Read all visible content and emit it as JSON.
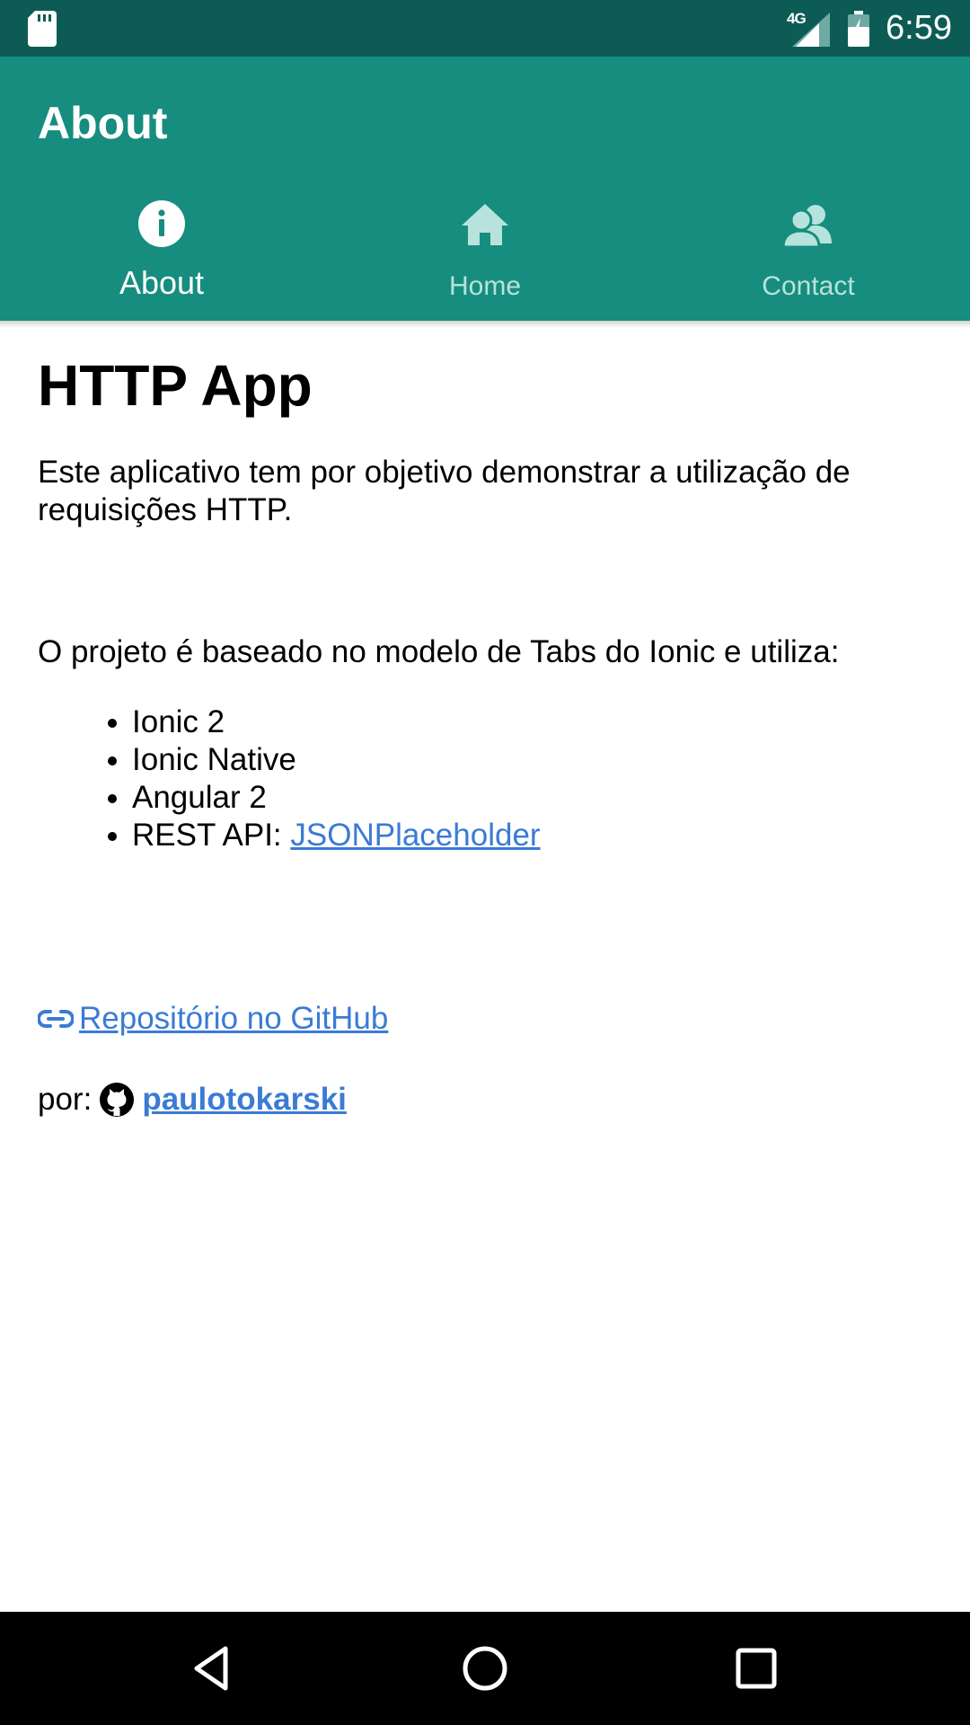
{
  "status_bar": {
    "network": "4G",
    "time": "6:59",
    "icons": [
      "sd-card-icon",
      "signal-icon",
      "battery-icon"
    ]
  },
  "toolbar": {
    "title": "About"
  },
  "tabs": [
    {
      "label": "About",
      "icon": "info-icon",
      "active": true
    },
    {
      "label": "Home",
      "icon": "home-icon",
      "active": false
    },
    {
      "label": "Contact",
      "icon": "contacts-icon",
      "active": false
    }
  ],
  "content": {
    "title": "HTTP App",
    "intro": "Este aplicativo tem por objetivo demonstrar a utilização de requisições HTTP.",
    "based_on": "O projeto é baseado no modelo de Tabs do Ionic e utiliza:",
    "tech_list": [
      "Ionic 2",
      "Ionic Native",
      "Angular 2"
    ],
    "rest_api_label": "REST API: ",
    "rest_api_link": "JSONPlaceholder",
    "repo_link": " Repositório no GitHub",
    "author_prefix": "por:",
    "author_link": "paulotokarski"
  },
  "nav_bar": {
    "buttons": [
      "back-icon",
      "home-circle-icon",
      "recent-apps-icon"
    ]
  },
  "colors": {
    "status_bar": "#0c5c55",
    "header": "#168d7e",
    "tab_inactive": "#b7e3dc",
    "link": "#3a7bd5",
    "nav_bar": "#000000"
  }
}
